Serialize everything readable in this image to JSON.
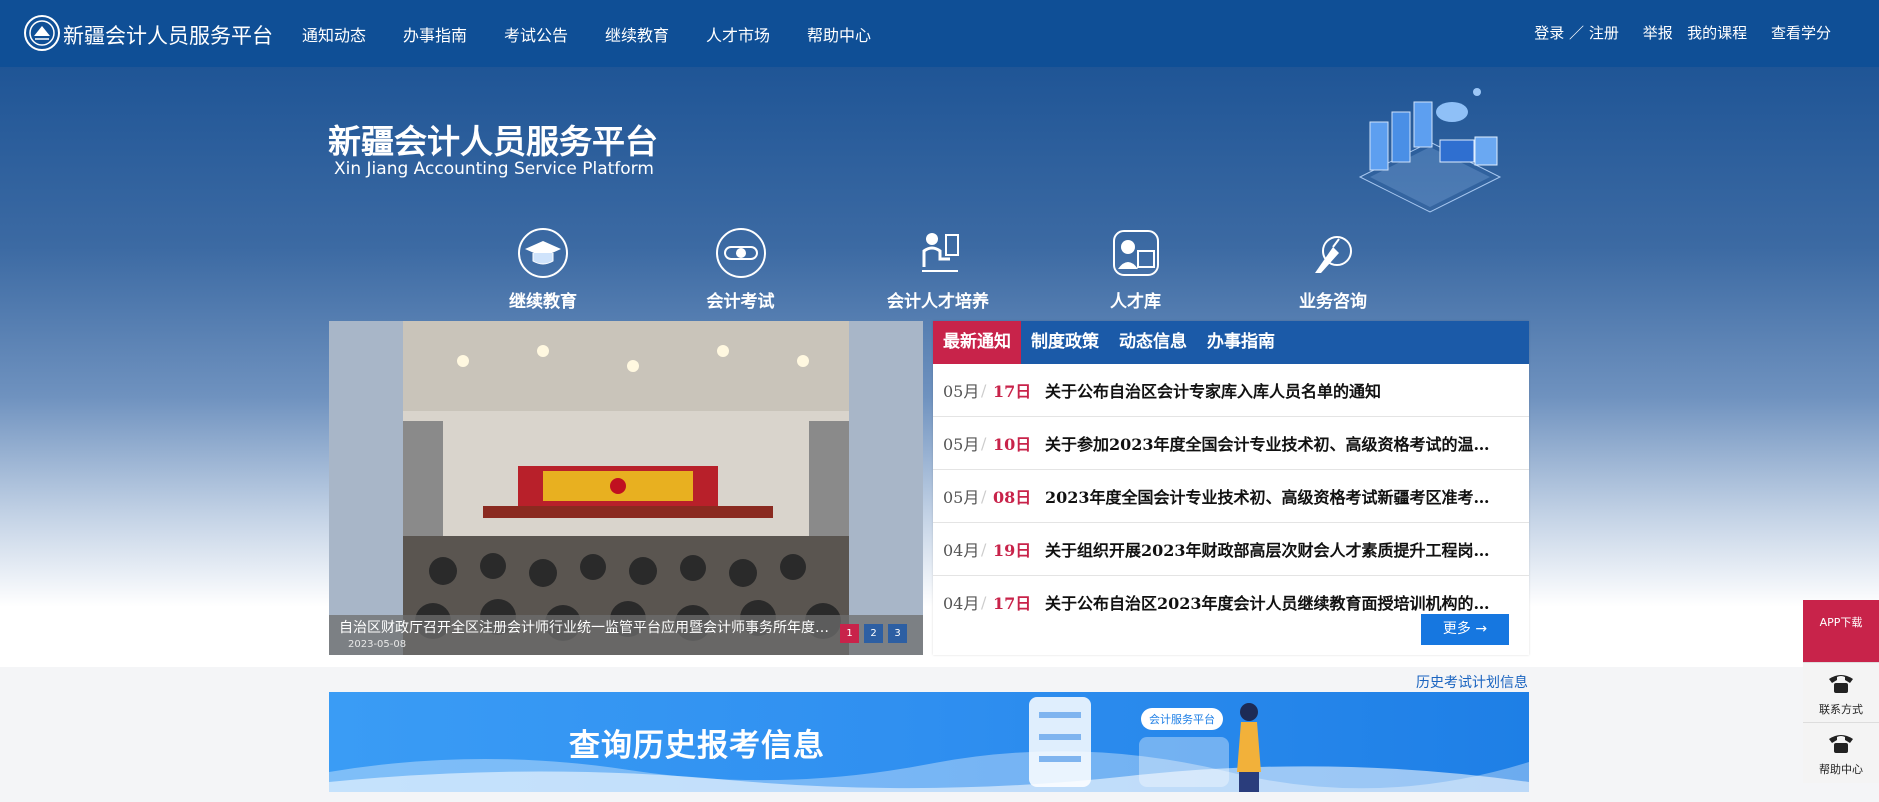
{
  "header": {
    "site_name": "新疆会计人员服务平台",
    "nav": [
      "通知动态",
      "办事指南",
      "考试公告",
      "继续教育",
      "人才市场",
      "帮助中心"
    ],
    "login": "登录",
    "register": "注册",
    "report": "举报",
    "my_courses": "我的课程",
    "view_credits": "查看学分"
  },
  "hero": {
    "title": "新疆会计人员服务平台",
    "subtitle": "Xin Jiang Accounting Service Platform",
    "categories": [
      {
        "label": "继续教育",
        "icon": "graduation-cap-icon"
      },
      {
        "label": "会计考试",
        "icon": "exam-scroll-icon"
      },
      {
        "label": "会计人才培养",
        "icon": "person-at-desk-icon"
      },
      {
        "label": "人才库",
        "icon": "id-card-icon"
      },
      {
        "label": "业务咨询",
        "icon": "pen-consult-icon"
      }
    ]
  },
  "slider": {
    "caption": "自治区财政厅召开全区注册会计师行业统一监管平台应用暨会计师事务所年度…",
    "date": "2023-05-08",
    "pages": [
      "1",
      "2",
      "3"
    ],
    "active_page": "1"
  },
  "news": {
    "tabs": [
      "最新通知",
      "制度政策",
      "动态信息",
      "办事指南"
    ],
    "active_tab": "最新通知",
    "items": [
      {
        "month": "05月",
        "day": "17日",
        "title": "关于公布自治区会计专家库入库人员名单的通知"
      },
      {
        "month": "05月",
        "day": "10日",
        "title": "关于参加2023年度全国会计专业技术初、高级资格考试的温…"
      },
      {
        "month": "05月",
        "day": "08日",
        "title": "2023年度全国会计专业技术初、高级资格考试新疆考区准考…"
      },
      {
        "month": "04月",
        "day": "19日",
        "title": "关于组织开展2023年财政部高层次财会人才素质提升工程岗…"
      },
      {
        "month": "04月",
        "day": "17日",
        "title": "关于公布自治区2023年度会计人员继续教育面授培训机构的…"
      }
    ],
    "more": "更多 →"
  },
  "history_link": "历史考试计划信息",
  "banner": {
    "text": "查询历史报考信息",
    "badge": "会计服务平台"
  },
  "side": {
    "app": "APP下载",
    "contact": "联系方式",
    "help": "帮助中心"
  },
  "colors": {
    "header": "#0f4f96",
    "accent_red": "#c8234a",
    "tab_blue": "#1b5aa8",
    "button_blue": "#1677e0"
  }
}
